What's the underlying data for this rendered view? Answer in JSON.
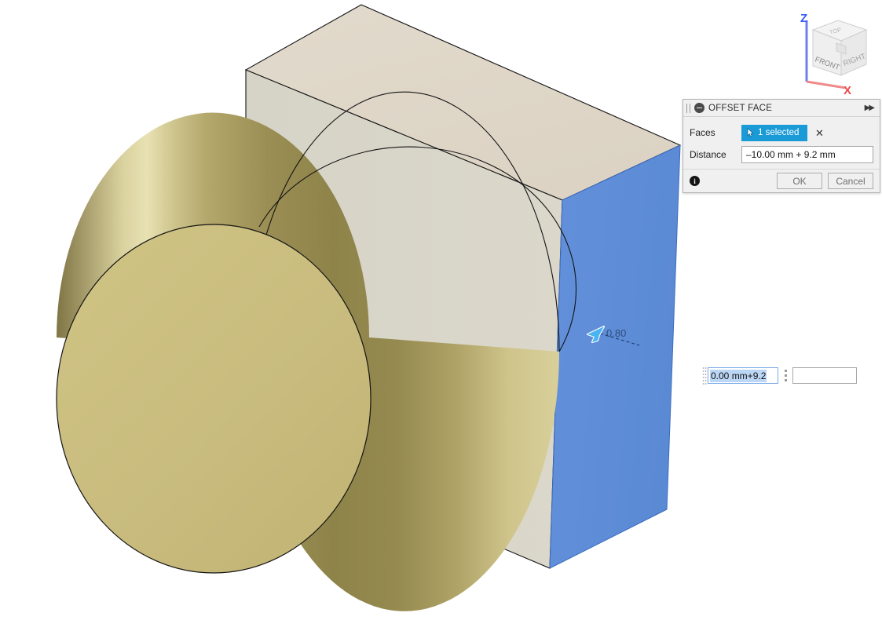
{
  "app": {
    "background_color": "#ffffff",
    "viewport_name": "3d-cad-viewport"
  },
  "viewcube": {
    "name": "view-cube",
    "faces": {
      "top": "TOP",
      "front": "FRONT",
      "right": "RIGHT"
    },
    "axes": [
      {
        "label": "Z",
        "color": "#3a5cf0"
      },
      {
        "label": "X",
        "color": "#f04a4a"
      }
    ]
  },
  "dialog": {
    "title": "OFFSET FACE",
    "collapse_icon": "minus-icon",
    "expand_icon": "double-chevron-right-icon",
    "rows": {
      "faces": {
        "label": "Faces",
        "selection_text": "1 selected",
        "selection_color": "#1a9ad6",
        "cursor_icon": "cursor-arrow-icon",
        "clear_icon": "close-x-icon"
      },
      "distance": {
        "label": "Distance",
        "value": "–10.00 mm + 9.2 mm",
        "placeholder": "Distance"
      }
    },
    "footer": {
      "info_icon": "info-icon",
      "info_glyph": "i",
      "ok_label": "OK",
      "cancel_label": "Cancel"
    }
  },
  "inline_editor": {
    "name": "inline-distance-editor",
    "selected_value": "0.00 mm+9.2",
    "grip_icon": "drag-grip-icon",
    "dots_icon": "vertical-dots-icon",
    "secondary_value": "",
    "secondary_placeholder": ""
  },
  "annotation": {
    "dimension_value": "0.80",
    "cursor_icon": "cursor-arrow-icon",
    "leader_style": "dashed",
    "text_color": "#2f4f7e"
  },
  "geometry": {
    "box": {
      "name": "rectangular-block",
      "top_face_color": "#ded5c6",
      "front_face_color": "#d6d2c5",
      "selected_face_color": "#5b8ed6",
      "edge_color": "#141414"
    },
    "cylinder": {
      "name": "brass-cylinder",
      "end_face_color": "#c9bc80",
      "body_highlight_color": "#e2dba5",
      "body_shadow_color": "#7e7342",
      "edge_color": "#141414"
    }
  }
}
